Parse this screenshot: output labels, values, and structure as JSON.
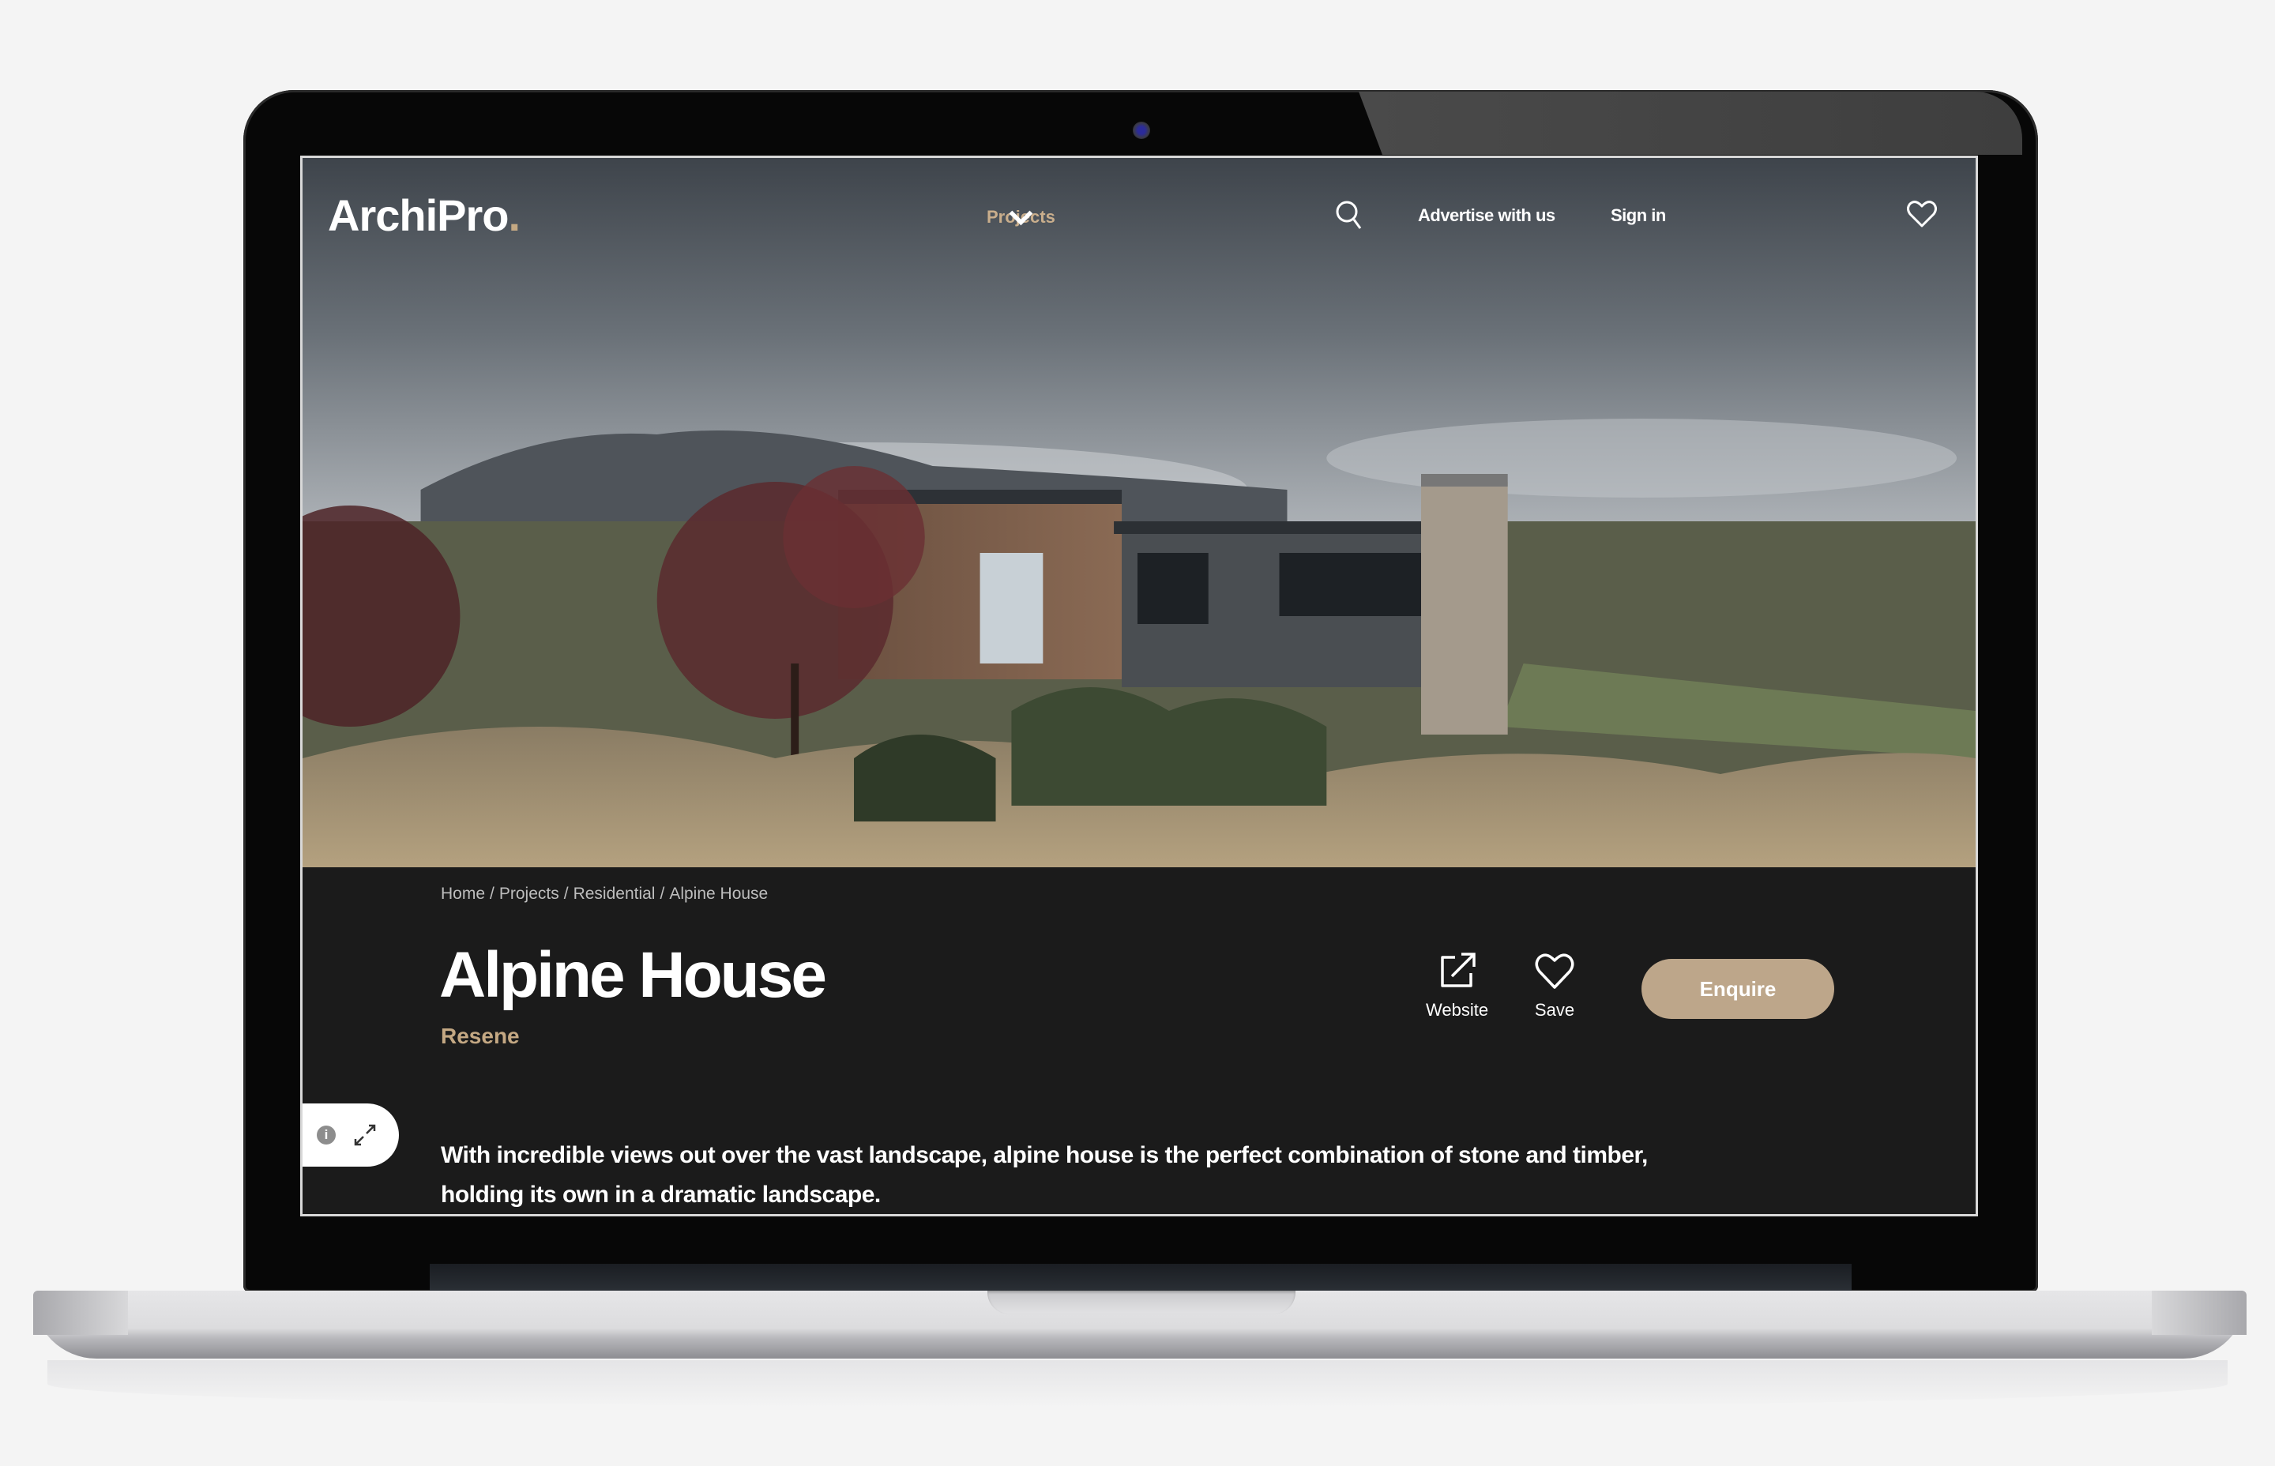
{
  "nav": {
    "logo_text": "ArchiPro",
    "logo_dot": ".",
    "projects_label": "Projects",
    "advertise_label": "Advertise with us",
    "signin_label": "Sign in"
  },
  "hero": {
    "image_alt": "Alpine house with timber and stone facade amid tussock grasses and mountain landscape"
  },
  "breadcrumb": [
    "Home",
    "Projects",
    "Residential",
    "Alpine House"
  ],
  "breadcrumb_separator": "/",
  "project": {
    "title": "Alpine House",
    "brand": "Resene",
    "description": "With incredible views out over the vast landscape, alpine house is the perfect combination of stone and timber, holding its own in a dramatic landscape."
  },
  "actions": {
    "website_label": "Website",
    "save_label": "Save",
    "enquire_label": "Enquire"
  },
  "image_controls": {
    "info_glyph": "i"
  },
  "colors": {
    "accent": "#c4a883",
    "enquire_bg": "#bda68a",
    "content_bg": "#1b1b1b",
    "projects_nav": "#c9ae8c"
  }
}
